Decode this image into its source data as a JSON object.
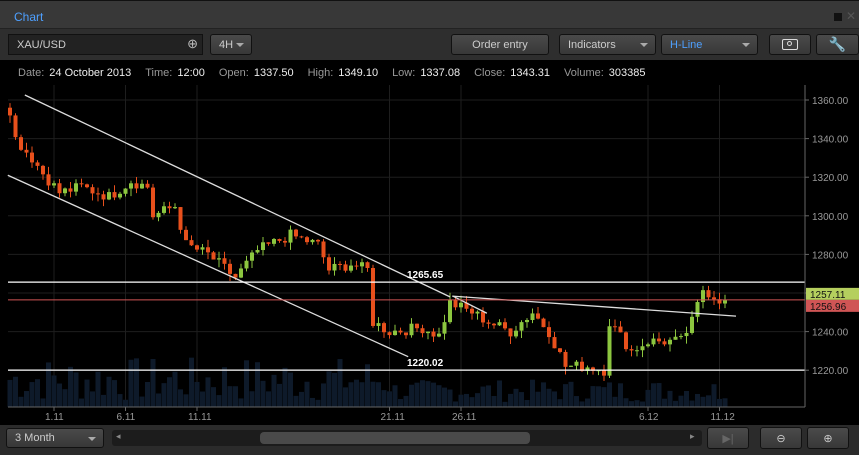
{
  "window": {
    "title": "Chart"
  },
  "toolbar": {
    "symbol": "XAU/USD",
    "timeframe": "4H",
    "order_entry": "Order entry",
    "indicators": "Indicators",
    "drawing_tool": "H-Line"
  },
  "info": {
    "date_label": "Date:",
    "date": "24 October 2013",
    "time_label": "Time:",
    "time": "12:00",
    "open_label": "Open:",
    "open": "1337.50",
    "high_label": "High:",
    "high": "1349.10",
    "low_label": "Low:",
    "low": "1337.08",
    "close_label": "Close:",
    "close": "1343.31",
    "volume_label": "Volume:",
    "volume": "303385"
  },
  "bottom": {
    "range": "3 Month"
  },
  "colors": {
    "up": "#8cc63f",
    "down": "#e8501c",
    "accent": "#4ea0ff",
    "bid": "#b5cf5e",
    "ask": "#d05555"
  },
  "chart_data": {
    "type": "candlestick",
    "ylim": [
      1210,
      1365
    ],
    "y_ticks": [
      "1360.00",
      "1340.00",
      "1320.00",
      "1300.00",
      "1280.00",
      "1260.00",
      "1240.00",
      "1220.00"
    ],
    "x_ticks": [
      {
        "i": 8,
        "label": "1.11"
      },
      {
        "i": 21,
        "label": "6.11"
      },
      {
        "i": 34,
        "label": "11.11"
      },
      {
        "i": 69,
        "label": "21.11"
      },
      {
        "i": 82,
        "label": "26.11"
      },
      {
        "i": 116,
        "label": "6.12"
      },
      {
        "i": 129,
        "label": "11.12"
      }
    ],
    "candle_count": 131,
    "close_anchors": [
      [
        0,
        1355
      ],
      [
        1,
        1340
      ],
      [
        4,
        1330
      ],
      [
        6,
        1322
      ],
      [
        9,
        1312
      ],
      [
        13,
        1315
      ],
      [
        18,
        1310
      ],
      [
        22,
        1318
      ],
      [
        25,
        1315
      ],
      [
        26,
        1300
      ],
      [
        30,
        1305
      ],
      [
        32,
        1285
      ],
      [
        36,
        1280
      ],
      [
        41,
        1268
      ],
      [
        45,
        1282
      ],
      [
        51,
        1290
      ],
      [
        56,
        1285
      ],
      [
        58,
        1272
      ],
      [
        62,
        1275
      ],
      [
        65,
        1272
      ],
      [
        66,
        1245
      ],
      [
        69,
        1240
      ],
      [
        75,
        1242
      ],
      [
        78,
        1238
      ],
      [
        80,
        1255
      ],
      [
        84,
        1250
      ],
      [
        87,
        1245
      ],
      [
        91,
        1240
      ],
      [
        95,
        1250
      ],
      [
        98,
        1240
      ],
      [
        101,
        1222
      ],
      [
        105,
        1222
      ],
      [
        108,
        1220
      ],
      [
        109,
        1245
      ],
      [
        113,
        1230
      ],
      [
        116,
        1235
      ],
      [
        122,
        1235
      ],
      [
        124,
        1245
      ],
      [
        126,
        1262
      ],
      [
        130,
        1255
      ]
    ],
    "trend_lines": [
      {
        "from": [
          2.7,
          1362.6
        ],
        "to": [
          80,
          1258
        ]
      },
      {
        "from": [
          -0.4,
          1321
        ],
        "to": [
          72.4,
          1227
        ]
      },
      {
        "from": [
          80.4,
          1258.4
        ],
        "to": [
          132,
          1248
        ]
      },
      {
        "from": [
          80.5,
          1258.4
        ],
        "to": [
          86.7,
          1249.5
        ]
      }
    ],
    "h_lines": [
      {
        "price": 1265.65,
        "label": "1265.65"
      },
      {
        "price": 1220.02,
        "label": "1220.02"
      }
    ],
    "bid": {
      "price": 1257.11,
      "label": "1257.11"
    },
    "ask": {
      "price": 1256.96,
      "label": "1256.96"
    }
  }
}
